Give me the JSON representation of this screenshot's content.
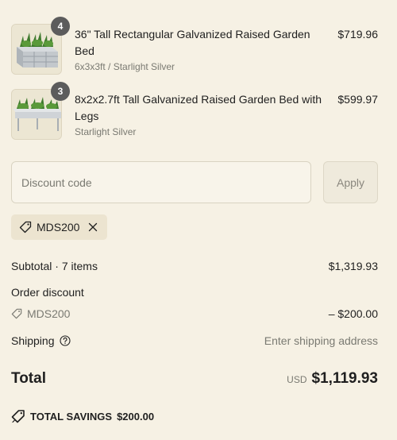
{
  "products": [
    {
      "quantity": "4",
      "title": "36\" Tall Rectangular Galvanized Raised Garden Bed",
      "variant": "6x3x3ft / Starlight Silver",
      "price": "$719.96"
    },
    {
      "quantity": "3",
      "title": "8x2x2.7ft Tall Galvanized Raised Garden Bed with Legs",
      "variant": "Starlight Silver",
      "price": "$599.97"
    }
  ],
  "discount": {
    "placeholder": "Discount code",
    "apply_label": "Apply",
    "applied_code": "MDS200"
  },
  "summary": {
    "subtotal_label": "Subtotal · 7 items",
    "subtotal_value": "$1,319.93",
    "order_discount_label": "Order discount",
    "discount_code": "MDS200",
    "discount_value": "– $200.00",
    "shipping_label": "Shipping",
    "shipping_value": "Enter shipping address",
    "total_label": "Total",
    "currency": "USD",
    "total_value": "$1,119.93",
    "savings_label": "TOTAL SAVINGS",
    "savings_value": "$200.00"
  },
  "icons": {
    "tag": "tag-icon",
    "close": "close-icon",
    "help": "help-circle-icon"
  },
  "colors": {
    "background": "#f6f1e4",
    "badge": "#5c5c5c",
    "chip": "#ece4d0"
  }
}
